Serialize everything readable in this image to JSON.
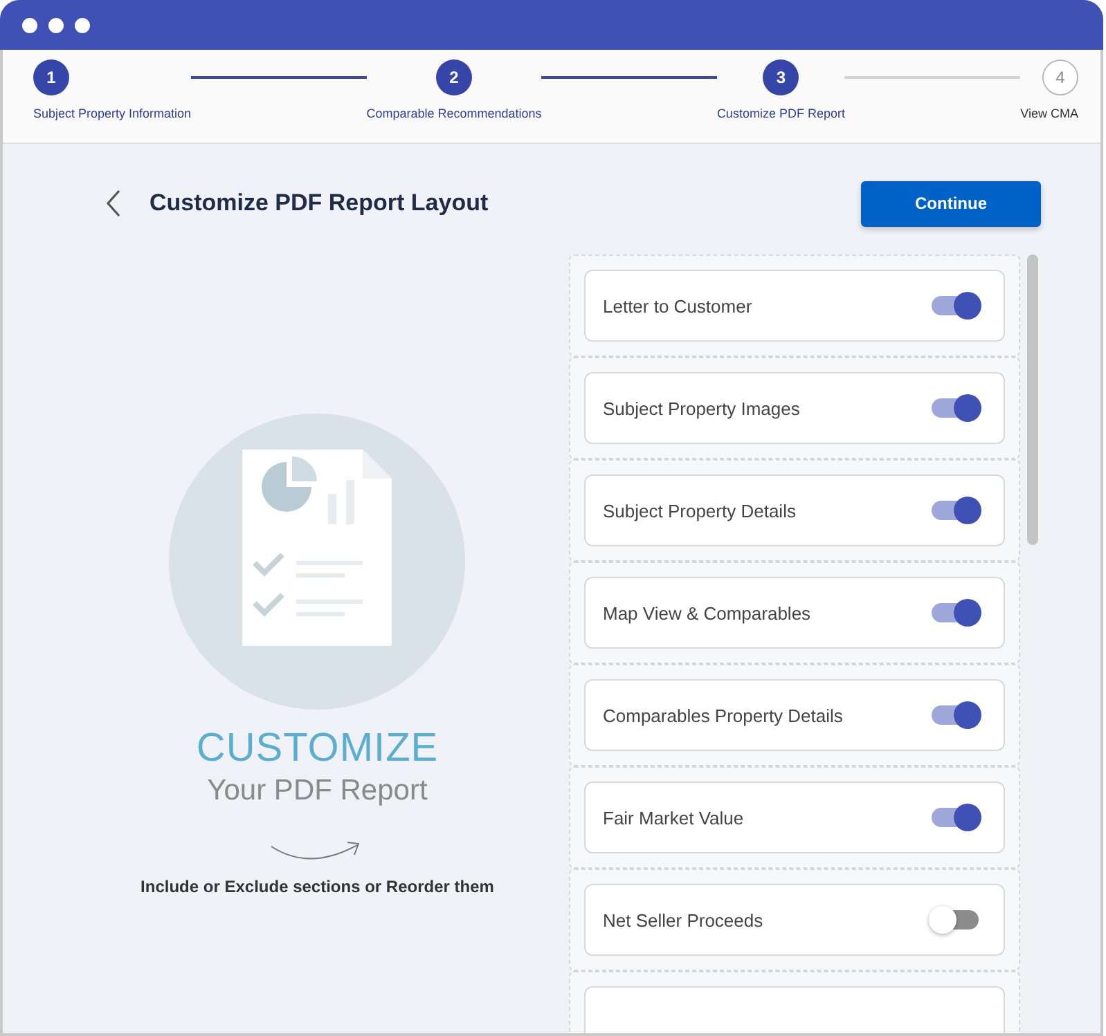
{
  "steps": [
    {
      "number": "1",
      "label": "Subject Property Information",
      "completed": true
    },
    {
      "number": "2",
      "label": "Comparable Recommendations",
      "completed": true
    },
    {
      "number": "3",
      "label": "Customize PDF Report",
      "completed": true
    },
    {
      "number": "4",
      "label": "View CMA",
      "completed": false
    }
  ],
  "header": {
    "title": "Customize PDF Report Layout",
    "continue_button": "Continue"
  },
  "illustration": {
    "headline": "CUSTOMIZE",
    "subheadline": "Your PDF Report",
    "caption": "Include or Exclude sections or Reorder them"
  },
  "sections": [
    {
      "kind": "section",
      "label": "Letter to Customer",
      "on": true
    },
    {
      "kind": "section",
      "label": "Subject Property Images",
      "on": true
    },
    {
      "kind": "section",
      "label": "Subject Property Details",
      "on": true
    },
    {
      "kind": "section",
      "label": "Map View & Comparables",
      "on": true
    },
    {
      "kind": "section",
      "label": "Comparables Property Details",
      "on": true
    },
    {
      "kind": "section",
      "label": "Fair Market Value",
      "on": true
    },
    {
      "kind": "section",
      "label": "Net Seller Proceeds",
      "on": false
    },
    {
      "kind": "partial"
    }
  ]
}
